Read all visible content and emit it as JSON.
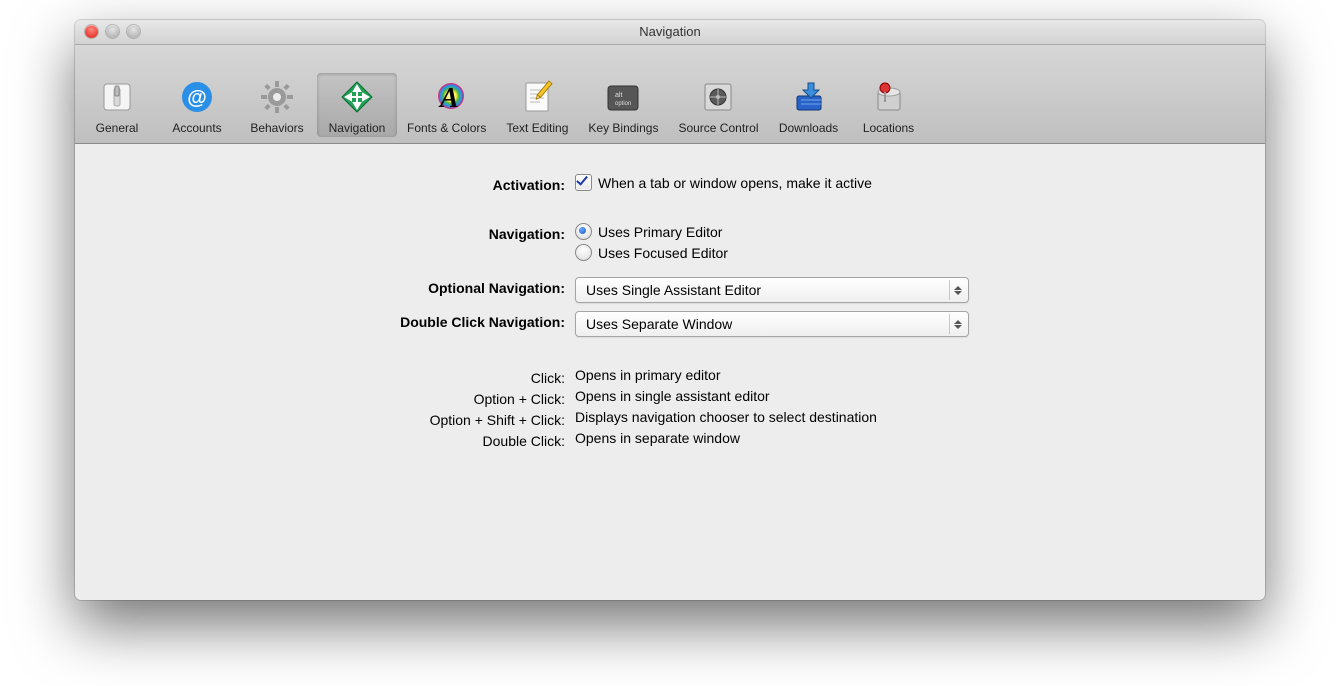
{
  "window": {
    "title": "Navigation"
  },
  "toolbar": {
    "items": [
      {
        "label": "General"
      },
      {
        "label": "Accounts"
      },
      {
        "label": "Behaviors"
      },
      {
        "label": "Navigation"
      },
      {
        "label": "Fonts & Colors"
      },
      {
        "label": "Text Editing"
      },
      {
        "label": "Key Bindings"
      },
      {
        "label": "Source Control"
      },
      {
        "label": "Downloads"
      },
      {
        "label": "Locations"
      }
    ],
    "selected_index": 3
  },
  "form": {
    "activation": {
      "label": "Activation:",
      "checkbox_label": "When a tab or window opens, make it active",
      "checked": true
    },
    "navigation": {
      "label": "Navigation:",
      "options": [
        {
          "label": "Uses Primary Editor",
          "selected": true
        },
        {
          "label": "Uses Focused Editor",
          "selected": false
        }
      ]
    },
    "optional_navigation": {
      "label": "Optional Navigation:",
      "value": "Uses Single Assistant Editor"
    },
    "double_click_navigation": {
      "label": "Double Click Navigation:",
      "value": "Uses Separate Window"
    },
    "hints": [
      {
        "label": "Click:",
        "value": "Opens in primary editor"
      },
      {
        "label": "Option + Click:",
        "value": "Opens in single assistant editor"
      },
      {
        "label": "Option + Shift + Click:",
        "value": "Displays navigation chooser to select destination"
      },
      {
        "label": "Double Click:",
        "value": "Opens in separate window"
      }
    ]
  }
}
